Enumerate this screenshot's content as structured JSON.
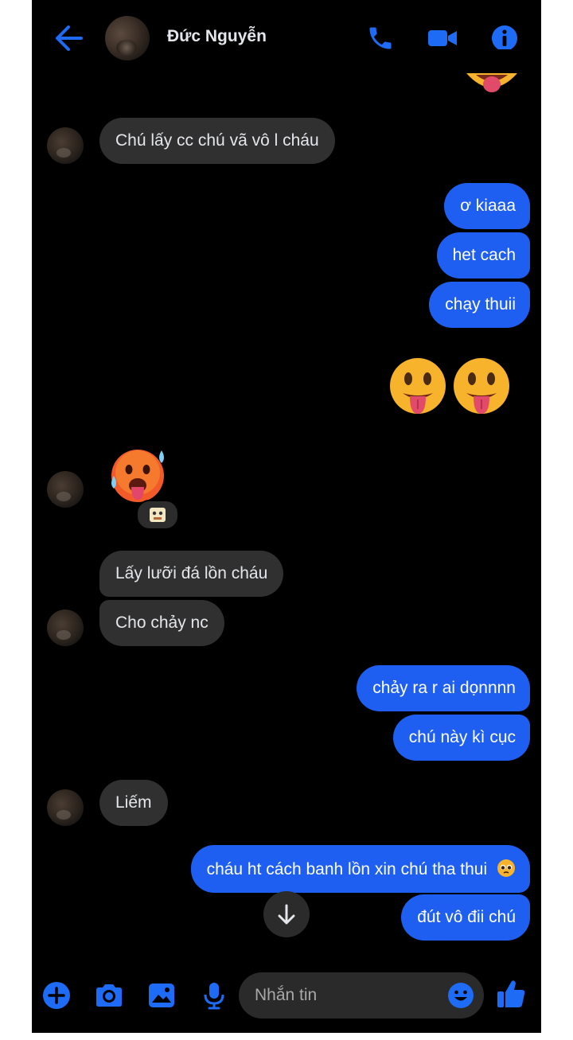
{
  "header": {
    "contact_name": "Đức Nguyễn",
    "icons": [
      "back-arrow-icon",
      "phone-icon",
      "video-camera-icon",
      "info-icon"
    ],
    "accent_color": "#1e6bf5"
  },
  "messages": [
    {
      "id": "m1",
      "side": "in",
      "text": "Chú lấy cc chú vã vô l cháu"
    },
    {
      "id": "m2",
      "side": "out",
      "text": "ơ kiaaa"
    },
    {
      "id": "m3",
      "side": "out",
      "text": "het cach"
    },
    {
      "id": "m4",
      "side": "out",
      "text": "chạy thuii"
    },
    {
      "id": "m5",
      "side": "out",
      "emoji": [
        "face-with-tongue-emoji",
        "face-with-tongue-emoji"
      ]
    },
    {
      "id": "m6",
      "side": "in",
      "emoji": [
        "hot-face-emoji"
      ],
      "reaction": "reaction-icon"
    },
    {
      "id": "m7",
      "side": "in",
      "text": "Lấy lưỡi đá lồn cháu"
    },
    {
      "id": "m8",
      "side": "in",
      "text": "Cho chảy nc"
    },
    {
      "id": "m9",
      "side": "out",
      "text": "chảy ra r ai dọnnnn"
    },
    {
      "id": "m10",
      "side": "out",
      "text": "chú này kì cục"
    },
    {
      "id": "m11",
      "side": "in",
      "text": "Liếm"
    },
    {
      "id": "m12",
      "side": "out",
      "text": "cháu ht cách banh lồn xin chú tha thui",
      "trailing_emoji": "pleading-face-emoji"
    },
    {
      "id": "m13",
      "side": "out",
      "text": "đút vô đii chú"
    }
  ],
  "composer": {
    "placeholder": "Nhắn tin",
    "icons": [
      "plus-icon",
      "camera-icon",
      "image-icon",
      "microphone-icon",
      "emoji-icon",
      "thumbs-up-icon"
    ]
  },
  "scroll_button_icon": "arrow-down-icon",
  "colors": {
    "background": "#000000",
    "incoming_bubble": "#303030",
    "outgoing_bubble": "#1e5ff2"
  }
}
